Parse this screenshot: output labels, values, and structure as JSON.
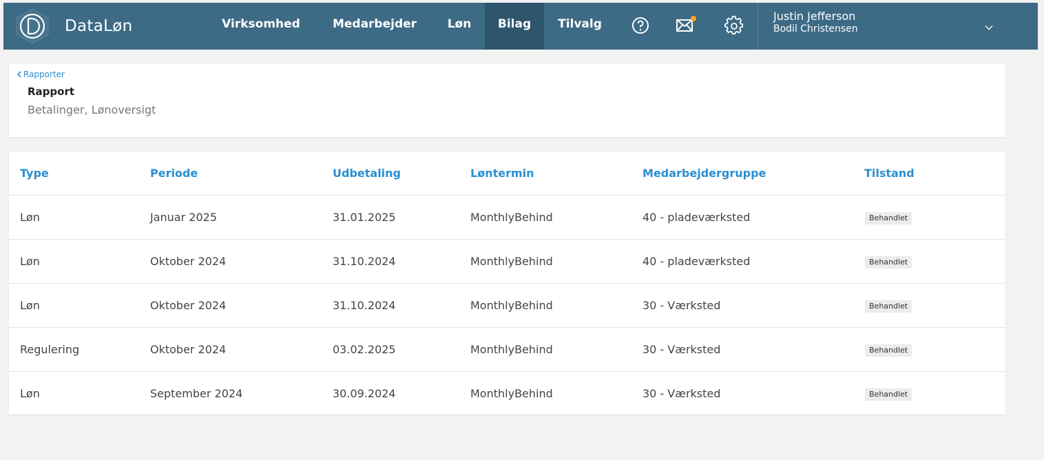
{
  "app": {
    "brand": "DataLøn"
  },
  "nav": {
    "items": [
      {
        "label": "Virksomhed"
      },
      {
        "label": "Medarbejder"
      },
      {
        "label": "Løn"
      },
      {
        "label": "Bilag",
        "active": true
      },
      {
        "label": "Tilvalg"
      }
    ],
    "icons": [
      "help-icon",
      "mail-icon",
      "settings-icon"
    ],
    "notification_dot_color": "#f5a623"
  },
  "user": {
    "name": "Justin Jefferson",
    "company": "Bodil Christensen"
  },
  "header": {
    "back_label": "Rapporter",
    "title": "Rapport",
    "subtitle": "Betalinger, Lønoversigt"
  },
  "table": {
    "columns": [
      "Type",
      "Periode",
      "Udbetaling",
      "Løntermin",
      "Medarbejdergruppe",
      "Tilstand"
    ],
    "rows": [
      [
        "Løn",
        "Januar 2025",
        "31.01.2025",
        "MonthlyBehind",
        "40 - pladeværksted",
        "Behandlet"
      ],
      [
        "Løn",
        "Oktober 2024",
        "31.10.2024",
        "MonthlyBehind",
        "40 - pladeværksted",
        "Behandlet"
      ],
      [
        "Løn",
        "Oktober 2024",
        "31.10.2024",
        "MonthlyBehind",
        "30 - Værksted",
        "Behandlet"
      ],
      [
        "Regulering",
        "Oktober 2024",
        "03.02.2025",
        "MonthlyBehind",
        "30 - Værksted",
        "Behandlet"
      ],
      [
        "Løn",
        "September 2024",
        "30.09.2024",
        "MonthlyBehind",
        "30 - Værksted",
        "Behandlet"
      ]
    ]
  },
  "colors": {
    "topbar": "#3d6a85",
    "active_nav": "#2e556c",
    "accent": "#2a8fd0"
  }
}
